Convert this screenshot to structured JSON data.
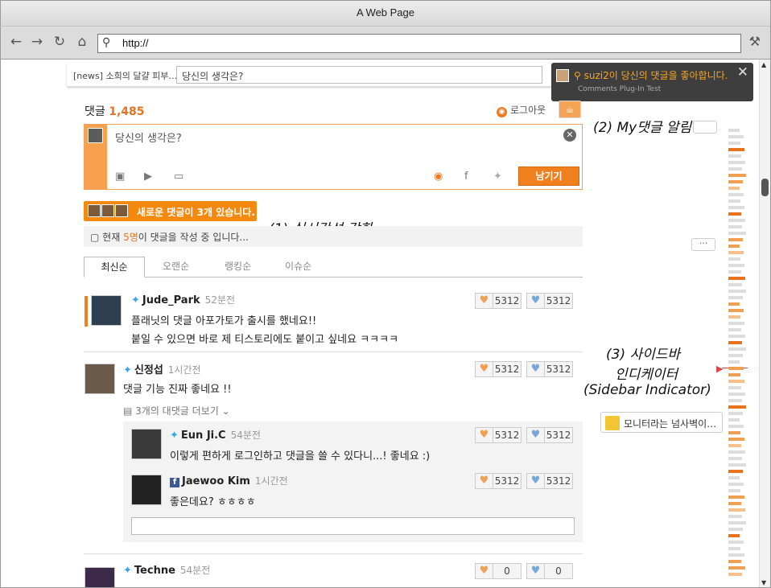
{
  "browser": {
    "title": "A Web Page",
    "url": "http://",
    "back_icon": "back-arrow-icon",
    "forward_icon": "forward-arrow-icon",
    "reload_icon": "reload-icon",
    "home_icon": "home-icon",
    "settings_icon": "wrench-icon"
  },
  "newsbar": {
    "tag": "[news] 소희의 달걀 피부…",
    "input_value": "당신의 생각은?"
  },
  "notification": {
    "message": "suzi2이 당신의 댓글을 좋아합니다.",
    "subtitle": "Comments Plug-In Test"
  },
  "annotations": {
    "a1": "(1) 실시간성 강화",
    "a2": "(2) My댓글 알림",
    "a3_l1": "(3) 사이드바",
    "a3_l2": "인디케이터",
    "a3_l3": "(Sidebar Indicator)"
  },
  "header": {
    "count_label": "댓글",
    "count_value": "1,485",
    "logout": "로그아웃"
  },
  "composer": {
    "placeholder": "당신의 생각은?",
    "submit": "남기기"
  },
  "new_comments": {
    "label": "새로운 댓글이 3개 있습니다."
  },
  "typing": {
    "prefix": "현재 ",
    "count": "5명",
    "suffix": "이 댓글을 작성 중 입니다..."
  },
  "tabs": [
    {
      "label": "최신순"
    },
    {
      "label": "오랜순"
    },
    {
      "label": "랭킹순"
    },
    {
      "label": "이슈순"
    }
  ],
  "comments": [
    {
      "name": "Jude_Park",
      "time": "52분전",
      "line1": "플래닛의 댓글 아포가토가 출시를 했네요!!",
      "line2": "붙일 수 있으면 바로 제 티스토리에도 붙이고 싶네요 ㅋㅋㅋㅋ",
      "likes": "5312",
      "dislikes": "5312"
    },
    {
      "name": "신정섭",
      "time": "1시간전",
      "line1": "댓글 기능 진짜 좋네요 !!",
      "likes": "5312",
      "dislikes": "5312"
    },
    {
      "name": "Techne",
      "time": "54분전",
      "likes": "0",
      "dislikes": "0"
    }
  ],
  "more_replies": "3개의 대댓글 더보기",
  "replies": [
    {
      "name": "Eun Ji.C",
      "time": "54분전",
      "text": "이렇게 편하게 로그인하고 댓글을 쓸 수 있다니...! 좋네요 :)",
      "likes": "5312",
      "dislikes": "5312"
    },
    {
      "name": "Jaewoo Kim",
      "time": "1시간전",
      "text": "좋은데요? ㅎㅎㅎㅎ",
      "likes": "5312",
      "dislikes": "5312"
    }
  ],
  "sidebar_preview": "모니터라는 넘사벽이…",
  "sidebar_dots": "···"
}
